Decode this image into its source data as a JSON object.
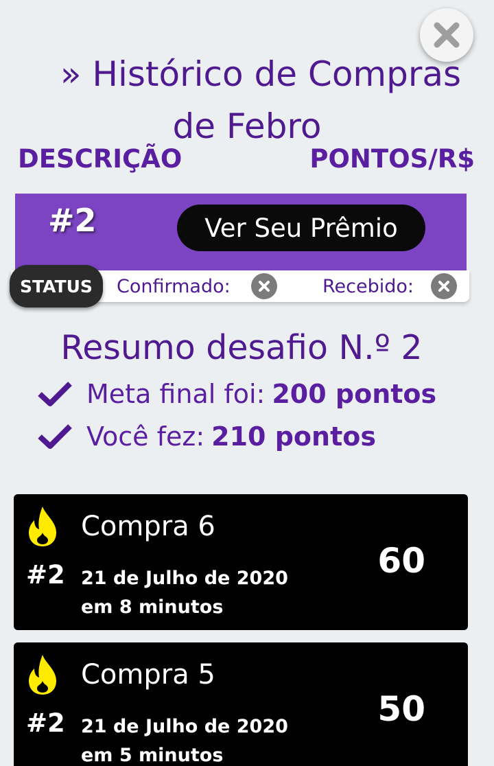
{
  "header": {
    "title_line1": "» Histórico de Compras",
    "title_line2": "de Febro",
    "col_description": "DESCRIÇÃO",
    "col_points": "PONTOS/R$"
  },
  "prize": {
    "number": "#2",
    "button_label": "Ver Seu Prêmio"
  },
  "status": {
    "label": "STATUS",
    "confirmed_label": "Confirmado:",
    "received_label": "Recebido:"
  },
  "summary": {
    "title": "Resumo desafio N.º 2",
    "goal_label": "Meta final foi:",
    "goal_value": "200 pontos",
    "done_label": "Você fez:",
    "done_value": "210 pontos"
  },
  "purchases": [
    {
      "name": "Compra 6",
      "hash": "#2",
      "date": "21 de Julho de 2020",
      "time": "em 8 minutos",
      "points": "60"
    },
    {
      "name": "Compra 5",
      "hash": "#2",
      "date": "21 de Julho de 2020",
      "time": "em 5 minutos",
      "points": "50"
    }
  ],
  "colors": {
    "purple_text": "#4f1a8f",
    "prize_bg": "#7c44c2",
    "flame": "#ffeb00"
  }
}
